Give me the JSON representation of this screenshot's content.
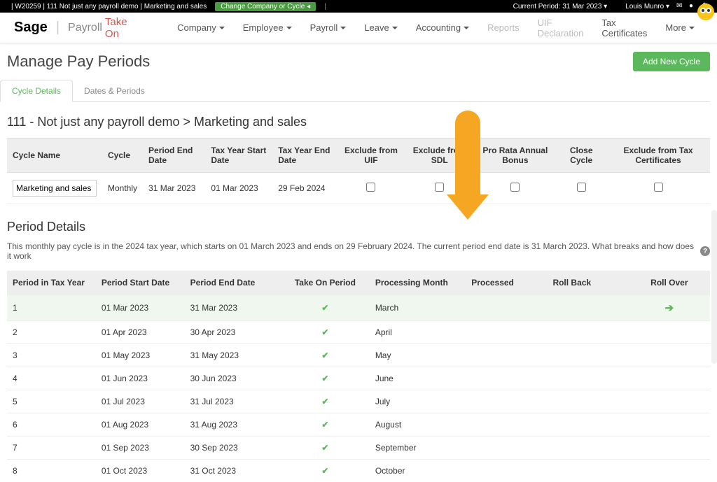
{
  "topbar": {
    "context": "| W20259 | 111 Not just any payroll demo | Marketing and sales",
    "change_btn": "Change Company or Cycle ◂",
    "current_period": "Current Period: 31 Mar 2023  ▾",
    "user": "Louis Munro  ▾"
  },
  "brand": {
    "sage": "Sage",
    "payroll": "Payroll",
    "takeon": "Take On"
  },
  "menu": {
    "company": "Company",
    "employee": "Employee",
    "payroll": "Payroll",
    "leave": "Leave",
    "accounting": "Accounting",
    "reports": "Reports",
    "uif": "UIF Declaration",
    "tax_certs": "Tax Certificates",
    "more": "More"
  },
  "page_title": "Manage Pay Periods",
  "add_btn": "Add New Cycle",
  "tabs": {
    "cycle_details": "Cycle Details",
    "dates_periods": "Dates & Periods"
  },
  "breadcrumb": "111 - Not just any payroll demo > Marketing and sales",
  "cycle_table": {
    "headers": {
      "name": "Cycle Name",
      "cycle": "Cycle",
      "ped": "Period End Date",
      "tysd": "Tax Year Start Date",
      "tyed": "Tax Year End Date",
      "ex_uif": "Exclude from UIF",
      "ex_sdl": "Exclude from SDL",
      "prorata": "Pro Rata Annual Bonus",
      "close": "Close Cycle",
      "ex_tax": "Exclude from Tax Certificates"
    },
    "row": {
      "name_value": "Marketing and sales",
      "cycle": "Monthly",
      "ped": "31 Mar 2023",
      "tysd": "01 Mar 2023",
      "tyed": "29 Feb 2024"
    }
  },
  "period_details": {
    "title": "Period Details",
    "desc": "This monthly pay cycle is in the 2024 tax year, which starts on 01 March 2023 and ends on 29 February 2024. The current period end date is 31 March 2023. What breaks and how does it work",
    "headers": {
      "num": "Period in Tax Year",
      "start": "Period Start Date",
      "end": "Period End Date",
      "takeon": "Take On Period",
      "month": "Processing Month",
      "processed": "Processed",
      "rollback": "Roll Back",
      "rollover": "Roll Over"
    },
    "rows": [
      {
        "n": "1",
        "s": "01 Mar 2023",
        "e": "31 Mar 2023",
        "m": "March",
        "hl": true,
        "ro": true
      },
      {
        "n": "2",
        "s": "01 Apr 2023",
        "e": "30 Apr 2023",
        "m": "April"
      },
      {
        "n": "3",
        "s": "01 May 2023",
        "e": "31 May 2023",
        "m": "May"
      },
      {
        "n": "4",
        "s": "01 Jun 2023",
        "e": "30 Jun 2023",
        "m": "June"
      },
      {
        "n": "5",
        "s": "01 Jul 2023",
        "e": "31 Jul 2023",
        "m": "July"
      },
      {
        "n": "6",
        "s": "01 Aug 2023",
        "e": "31 Aug 2023",
        "m": "August"
      },
      {
        "n": "7",
        "s": "01 Sep 2023",
        "e": "30 Sep 2023",
        "m": "September"
      },
      {
        "n": "8",
        "s": "01 Oct 2023",
        "e": "31 Oct 2023",
        "m": "October"
      }
    ]
  }
}
